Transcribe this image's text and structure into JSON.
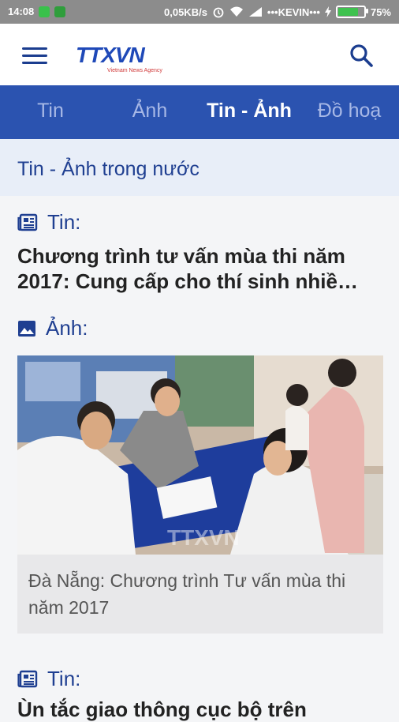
{
  "status_bar": {
    "time": "14:08",
    "network_speed": "0,05KB/s",
    "carrier": "•••KEVIN•••",
    "battery": "75%"
  },
  "app_bar": {
    "logo": "TTXVN",
    "logo_tagline": "Vietnam News Agency"
  },
  "tabs": [
    {
      "label": "Tin"
    },
    {
      "label": "Ảnh"
    },
    {
      "label": "Tin - Ảnh"
    },
    {
      "label": "Đồ hoạ"
    }
  ],
  "section": {
    "title": "Tin - Ảnh trong nước"
  },
  "articles": [
    {
      "type_label": "Tin:",
      "headline": "Chương trình tư vấn mùa thi năm 2017: Cung cấp cho thí sinh nhiề…"
    },
    {
      "type_label": "Ảnh:",
      "caption": "Đà Nẵng: Chương trình Tư vấn mùa thi năm 2017"
    },
    {
      "type_label": "Tin:",
      "headline": "Ùn tắc giao thông cục bộ trên"
    }
  ],
  "colors": {
    "brand_blue": "#2b53b0",
    "dark_blue": "#1f3f91",
    "section_bg": "#e8eef8"
  },
  "icons": [
    "menu-icon",
    "search-icon",
    "newspaper-icon",
    "image-icon"
  ]
}
